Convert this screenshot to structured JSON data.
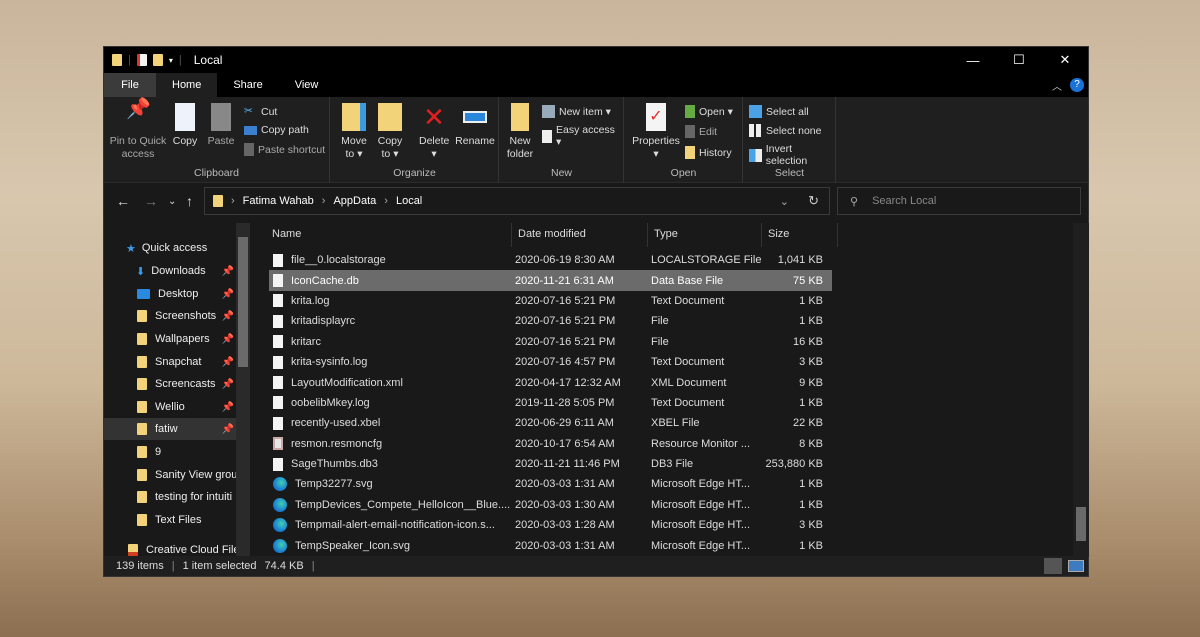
{
  "window": {
    "title": "Local",
    "controls": {
      "minimize": "—",
      "maximize": "☐",
      "close": "✕"
    }
  },
  "tabs": [
    {
      "label": "File"
    },
    {
      "label": "Home"
    },
    {
      "label": "Share"
    },
    {
      "label": "View"
    }
  ],
  "ribbon": {
    "clipboard": {
      "label": "Clipboard",
      "pin": "Pin to Quick access",
      "copy": "Copy",
      "paste": "Paste",
      "cut": "Cut",
      "copy_path": "Copy path",
      "paste_shortcut": "Paste shortcut"
    },
    "organize": {
      "label": "Organize",
      "move_to": "Move to",
      "copy_to": "Copy to",
      "delete": "Delete",
      "rename": "Rename"
    },
    "new": {
      "label": "New",
      "new_folder": "New folder",
      "new_item": "New item ▾",
      "easy_access": "Easy access ▾"
    },
    "open": {
      "label": "Open",
      "properties": "Properties",
      "open": "Open ▾",
      "edit": "Edit",
      "history": "History"
    },
    "select": {
      "label": "Select",
      "select_all": "Select all",
      "select_none": "Select none",
      "invert": "Invert selection"
    }
  },
  "address": {
    "crumbs": [
      "Fatima Wahab",
      "AppData",
      "Local"
    ]
  },
  "search": {
    "placeholder": "Search Local"
  },
  "sidebar": {
    "items": [
      {
        "label": "Quick access"
      },
      {
        "label": "Downloads",
        "pinned": true
      },
      {
        "label": "Desktop",
        "pinned": true
      },
      {
        "label": "Screenshots",
        "pinned": true
      },
      {
        "label": "Wallpapers",
        "pinned": true
      },
      {
        "label": "Snapchat",
        "pinned": true
      },
      {
        "label": "Screencasts",
        "pinned": true
      },
      {
        "label": "Wellio",
        "pinned": true
      },
      {
        "label": "fatiw",
        "pinned": true
      },
      {
        "label": "9"
      },
      {
        "label": "Sanity View grou"
      },
      {
        "label": "testing for intuiti"
      },
      {
        "label": "Text Files"
      },
      {
        "label": "Creative Cloud File"
      }
    ]
  },
  "columns": {
    "name": "Name",
    "date": "Date modified",
    "type": "Type",
    "size": "Size"
  },
  "files": [
    {
      "name": "file__0.localstorage",
      "date": "2020-06-19 8:30 AM",
      "type": "LOCALSTORAGE File",
      "size": "1,041 KB",
      "icon": "file"
    },
    {
      "name": "IconCache.db",
      "date": "2020-11-21 6:31 AM",
      "type": "Data Base File",
      "size": "75 KB",
      "icon": "file",
      "selected": true
    },
    {
      "name": "krita.log",
      "date": "2020-07-16 5:21 PM",
      "type": "Text Document",
      "size": "1 KB",
      "icon": "file"
    },
    {
      "name": "kritadisplayrc",
      "date": "2020-07-16 5:21 PM",
      "type": "File",
      "size": "1 KB",
      "icon": "file"
    },
    {
      "name": "kritarc",
      "date": "2020-07-16 5:21 PM",
      "type": "File",
      "size": "16 KB",
      "icon": "file"
    },
    {
      "name": "krita-sysinfo.log",
      "date": "2020-07-16 4:57 PM",
      "type": "Text Document",
      "size": "3 KB",
      "icon": "file"
    },
    {
      "name": "LayoutModification.xml",
      "date": "2020-04-17 12:32 AM",
      "type": "XML Document",
      "size": "9 KB",
      "icon": "file"
    },
    {
      "name": "oobelibMkey.log",
      "date": "2019-11-28 5:05 PM",
      "type": "Text Document",
      "size": "1 KB",
      "icon": "file"
    },
    {
      "name": "recently-used.xbel",
      "date": "2020-06-29 6:11 AM",
      "type": "XBEL File",
      "size": "22 KB",
      "icon": "file"
    },
    {
      "name": "resmon.resmoncfg",
      "date": "2020-10-17 6:54 AM",
      "type": "Resource Monitor ...",
      "size": "8 KB",
      "icon": "cfg"
    },
    {
      "name": "SageThumbs.db3",
      "date": "2020-11-21 11:46 PM",
      "type": "DB3 File",
      "size": "253,880 KB",
      "icon": "file"
    },
    {
      "name": "Temp32277.svg",
      "date": "2020-03-03 1:31 AM",
      "type": "Microsoft Edge HT...",
      "size": "1 KB",
      "icon": "edge"
    },
    {
      "name": "TempDevices_Compete_HelloIcon__Blue....",
      "date": "2020-03-03 1:30 AM",
      "type": "Microsoft Edge HT...",
      "size": "1 KB",
      "icon": "edge"
    },
    {
      "name": "Tempmail-alert-email-notification-icon.s...",
      "date": "2020-03-03 1:28 AM",
      "type": "Microsoft Edge HT...",
      "size": "3 KB",
      "icon": "edge"
    },
    {
      "name": "TempSpeaker_Icon.svg",
      "date": "2020-03-03 1:31 AM",
      "type": "Microsoft Edge HT...",
      "size": "1 KB",
      "icon": "edge"
    }
  ],
  "status": {
    "count": "139 items",
    "selected": "1 item selected",
    "size": "74.4 KB"
  }
}
